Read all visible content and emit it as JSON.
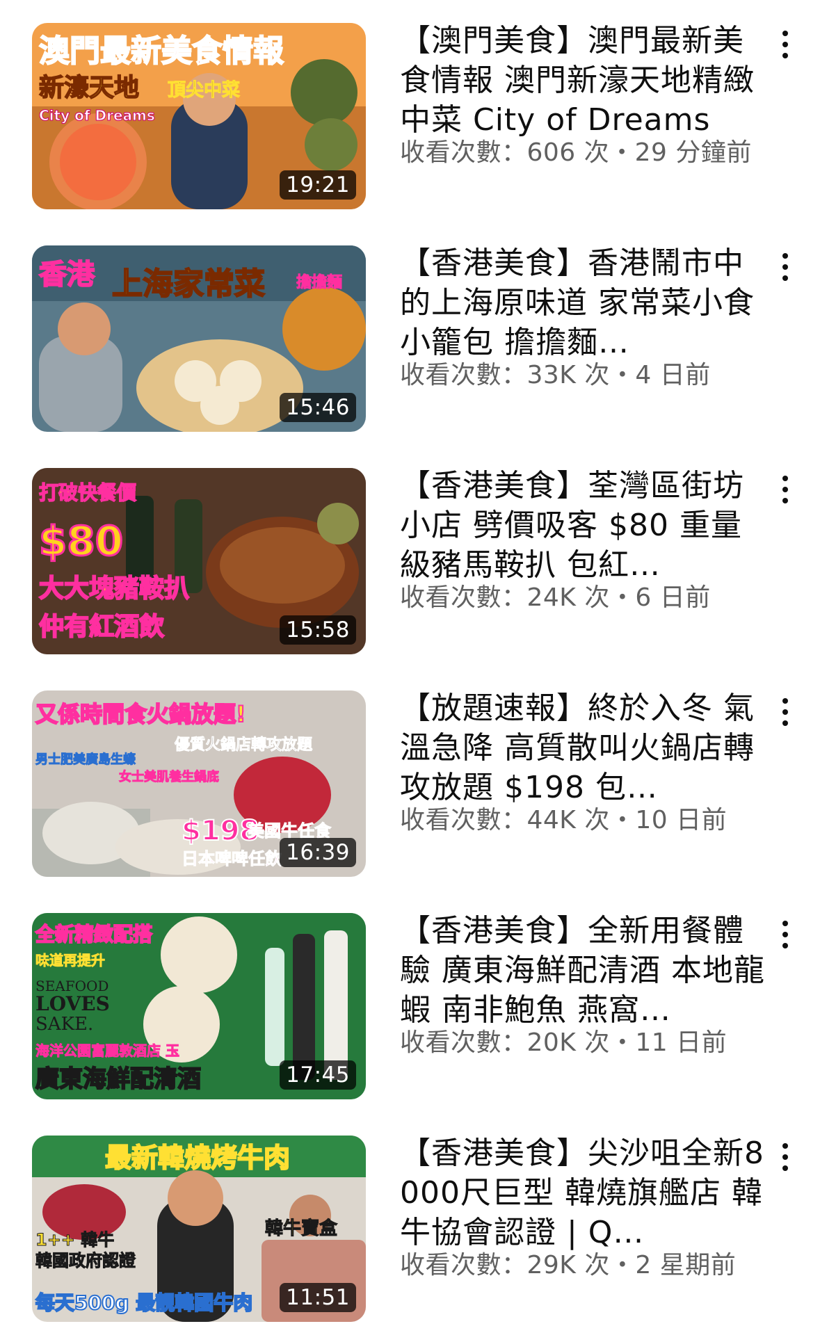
{
  "videos": [
    {
      "title": "【澳門美食】澳門最新美食情報 澳門新濠天地精緻中菜 City of Dreams",
      "meta": "收看次數：606 次・29 分鐘前",
      "duration": "19:21",
      "thumb_lines": [
        "澳門最新美食情報",
        "新濠天地",
        "頂尖中菜",
        "City of Dreams"
      ],
      "thumb_colors": {
        "bg": "#f28c28",
        "accent": "#ff3b30",
        "highlight": "#ffe033"
      }
    },
    {
      "title": "【香港美食】香港鬧市中的上海原味道 家常菜小食 小籠包 擔擔麵…",
      "meta": "收看次數：33K 次・4 日前",
      "duration": "15:46",
      "thumb_lines": [
        "香港",
        "上海家常菜",
        "擔擔麵"
      ],
      "thumb_colors": {
        "bg": "#4a6e7f",
        "accent": "#ff2fa0",
        "highlight": "#ffd21f"
      }
    },
    {
      "title": "【香港美食】荃灣區街坊小店 劈價吸客 $80 重量級豬馬鞍扒 包紅…",
      "meta": "收看次數：24K 次・6 日前",
      "duration": "15:58",
      "thumb_lines": [
        "打破快餐價",
        "$80",
        "大大塊豬鞍扒",
        "仲有紅酒飲"
      ],
      "thumb_colors": {
        "bg": "#3b2418",
        "accent": "#ff2fa0",
        "highlight": "#ffd21f"
      }
    },
    {
      "title": "【放題速報】終於入冬 氣溫急降 高質散叫火鍋店轉攻放題 $198 包…",
      "meta": "收看次數：44K 次・10 日前",
      "duration": "16:39",
      "thumb_lines": [
        "又係時間食火鍋放題!",
        "優質火鍋店轉攻放題",
        "男士肥美廣島生蠔",
        "女士美肌養生鍋底",
        "$198",
        "美國牛任食",
        "日本啤啤任飲"
      ],
      "thumb_colors": {
        "bg": "#c9c2bc",
        "accent": "#ff2fa0",
        "highlight": "#ffe033"
      }
    },
    {
      "title": "【香港美食】全新用餐體驗 廣東海鮮配清酒 本地龍蝦 南非鮑魚 燕窩…",
      "meta": "收看次數：20K 次・11 日前",
      "duration": "17:45",
      "thumb_lines": [
        "全新精緻配搭",
        "味道再提升",
        "SEAFOOD",
        "LOVES",
        "SAKE.",
        "海洋公園富麗敦酒店 玉",
        "廣東海鮮配清酒"
      ],
      "thumb_colors": {
        "bg": "#1f7a3a",
        "accent": "#ff2fa0",
        "highlight": "#ffe033"
      }
    },
    {
      "title": "【香港美食】尖沙咀全新8000尺巨型 韓燒旗艦店 韓牛協會認證 | Q…",
      "meta": "收看次數：29K 次・2 星期前",
      "duration": "11:51",
      "thumb_lines": [
        "最新韓燒烤牛肉",
        "1++ 韓牛",
        "韓國政府認證",
        "韓牛寶盒",
        "每天500g 最靚韓國牛肉"
      ],
      "thumb_colors": {
        "bg": "#d9d4cc",
        "accent": "#ff2fa0",
        "highlight": "#ffe033"
      }
    }
  ],
  "icons": {
    "more": "more-vertical-icon"
  }
}
